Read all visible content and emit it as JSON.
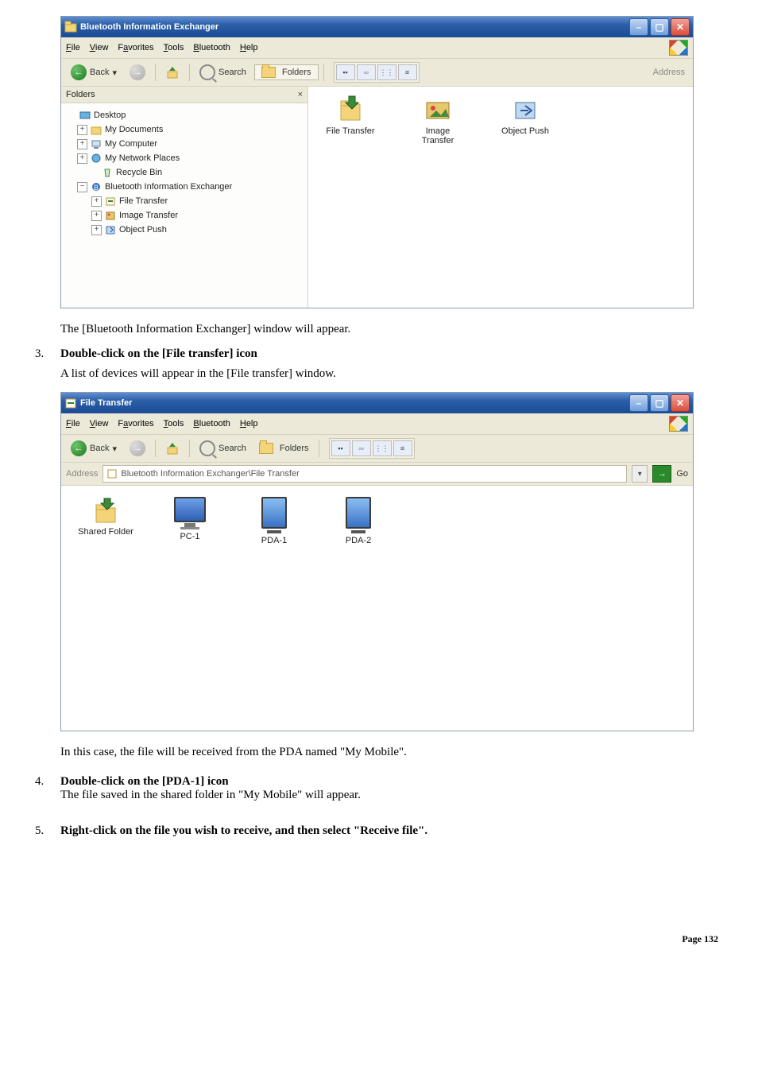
{
  "win1": {
    "title": "Bluetooth Information Exchanger",
    "menus": [
      "File",
      "View",
      "Favorites",
      "Tools",
      "Bluetooth",
      "Help"
    ],
    "back": "Back",
    "search": "Search",
    "folders_btn": "Folders",
    "address": "Address",
    "folders_header": "Folders",
    "tree": {
      "desktop": "Desktop",
      "mydocs": "My Documents",
      "mycomp": "My Computer",
      "netplaces": "My Network Places",
      "recycle": "Recycle Bin",
      "bie": "Bluetooth Information Exchanger",
      "ft": "File Transfer",
      "it": "Image Transfer",
      "op": "Object Push"
    },
    "icons": {
      "ft": "File Transfer",
      "it": "Image\nTransfer",
      "op": "Object Push"
    }
  },
  "caption1": "The [Bluetooth Information Exchanger] window will appear.",
  "step3": {
    "num": "3.",
    "title": "Double-click on the [File transfer] icon",
    "sub": "A list of devices will appear in the [File transfer] window."
  },
  "win2": {
    "title": "File Transfer",
    "menus": [
      "File",
      "View",
      "Favorites",
      "Tools",
      "Bluetooth",
      "Help"
    ],
    "back": "Back",
    "search": "Search",
    "folders_btn": "Folders",
    "address_label": "Address",
    "address_value": "Bluetooth Information Exchanger\\File Transfer",
    "go": "Go",
    "devices": {
      "shared": "Shared Folder",
      "pc1": "PC-1",
      "pda1": "PDA-1",
      "pda2": "PDA-2"
    }
  },
  "caption2": "In this case, the file will be received from the PDA named \"My Mobile\".",
  "step4": {
    "num": "4.",
    "title": "Double-click on the [PDA-1] icon",
    "sub": "The file saved in the shared folder in \"My Mobile\" will appear."
  },
  "step5": {
    "num": "5.",
    "title": "Right-click on the file you wish to receive, and then select \"Receive file\"."
  },
  "footer": "Page 132"
}
